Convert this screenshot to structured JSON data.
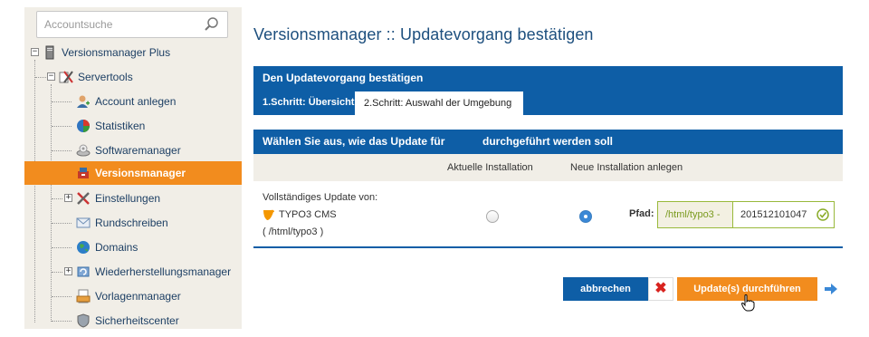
{
  "sidebar": {
    "search_placeholder": "Accountsuche",
    "root": "Versionsmanager Plus",
    "servertools": "Servertools",
    "items": [
      {
        "label": "Account anlegen"
      },
      {
        "label": "Statistiken"
      },
      {
        "label": "Softwaremanager"
      },
      {
        "label": "Versionsmanager"
      },
      {
        "label": "Einstellungen"
      },
      {
        "label": "Rundschreiben"
      },
      {
        "label": "Domains"
      },
      {
        "label": "Wiederherstellungsmanager"
      },
      {
        "label": "Vorlagenmanager"
      },
      {
        "label": "Sicherheitscenter"
      }
    ]
  },
  "main": {
    "title": "Versionsmanager :: Updatevorgang bestätigen",
    "panel_title": "Den Updatevorgang bestätigen",
    "step1": "1.Schritt: Übersicht",
    "step2": "2.Schritt: Auswahl der Umgebung",
    "section_a": "Wählen Sie aus, wie das Update für",
    "section_b": "durchgeführt werden soll",
    "col_current": "Aktuelle Installation",
    "col_new": "Neue Installation anlegen",
    "row_label": "Vollständiges Update von:",
    "app_name": "TYPO3 CMS",
    "app_path": "( /html/typo3 )",
    "path_label": "Pfad:",
    "path_prefix": "/html/typo3 -",
    "path_value": "201512101047",
    "cancel_label": "abbrechen",
    "cancel_x": "✖",
    "update_label": "Update(s) durchführen"
  },
  "colors": {
    "brand_blue": "#0e5ea6",
    "accent_orange": "#f28c1e",
    "sidebar_bg": "#f1eee7",
    "valid_green": "#99b93b"
  }
}
